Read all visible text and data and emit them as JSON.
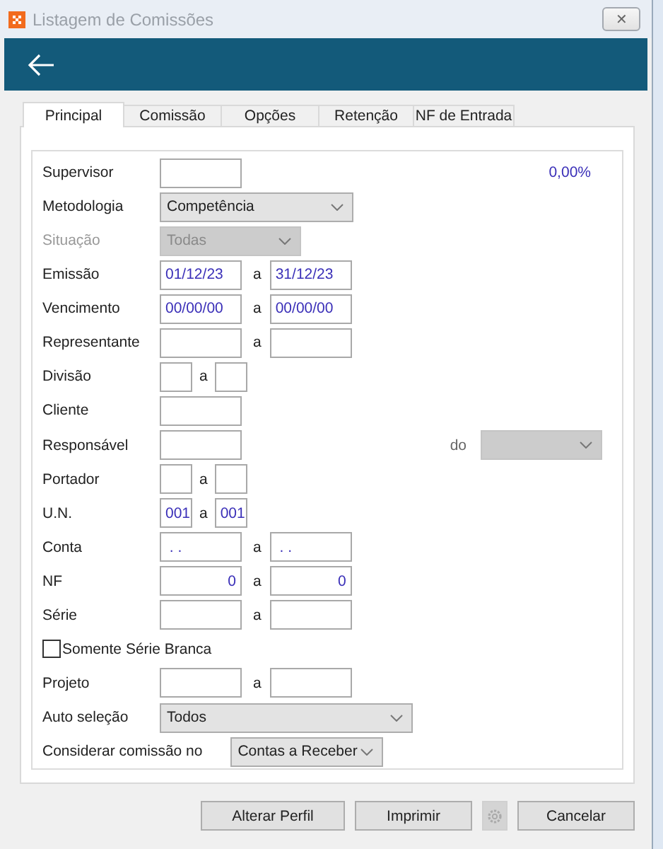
{
  "window": {
    "title": "Listagem de Comissões",
    "close": "✕"
  },
  "tabs": [
    {
      "label": "Principal",
      "selected": true
    },
    {
      "label": "Comissão",
      "selected": false
    },
    {
      "label": "Opções",
      "selected": false
    },
    {
      "label": "Retenção",
      "selected": false
    },
    {
      "label": "NF de Entrada",
      "selected": false
    }
  ],
  "rows": [
    {
      "kind": "input",
      "label": "Supervisor",
      "extra": {
        "kind": "text",
        "text": "0,00%"
      }
    },
    {
      "kind": "select",
      "label": "Metodologia",
      "value": "Competência",
      "disabled": false
    },
    {
      "kind": "select",
      "label": "Situação",
      "value": "Todas",
      "disabled": true
    },
    {
      "kind": "range",
      "label": "Emissão",
      "separator": "a",
      "values": [
        "01/12/23",
        "31/12/23"
      ]
    },
    {
      "kind": "range",
      "label": "Vencimento",
      "separator": "a",
      "values": [
        "00/00/00",
        "00/00/00"
      ]
    },
    {
      "kind": "range",
      "label": "Representante",
      "separator": "a"
    },
    {
      "kind": "range",
      "label": "Divisão",
      "separator": "a"
    },
    {
      "kind": "input",
      "label": "Cliente"
    },
    {
      "kind": "input",
      "label": "Responsável",
      "extra": {
        "kind": "select",
        "label": "do",
        "disabled": true
      }
    },
    {
      "kind": "range",
      "label": "Portador",
      "separator": "a"
    },
    {
      "kind": "range",
      "label": "U.N.",
      "separator": "a",
      "values": [
        "001",
        "001"
      ]
    },
    {
      "kind": "range",
      "label": "Conta",
      "separator": "a",
      "values": [
        " . .",
        " . ."
      ]
    },
    {
      "kind": "range",
      "label": "NF",
      "separator": "a",
      "values": [
        "0",
        "0"
      ]
    },
    {
      "kind": "range",
      "label": "Série",
      "separator": "a"
    },
    {
      "kind": "checkbox",
      "label": "Somente Série Branca",
      "checked": false
    },
    {
      "kind": "range",
      "label": "Projeto",
      "separator": "a"
    },
    {
      "kind": "select",
      "label": "Auto seleção",
      "value": "Todos",
      "disabled": false
    },
    {
      "kind": "select",
      "label": "Considerar comissão no",
      "value": "Contas a Receber",
      "disabled": false
    }
  ],
  "buttons": [
    {
      "kind": "text",
      "label": "Alterar Perfil",
      "disabled": false
    },
    {
      "kind": "text",
      "label": "Imprimir",
      "disabled": false
    },
    {
      "kind": "gear",
      "disabled": true
    },
    {
      "kind": "text",
      "label": "Cancelar",
      "disabled": false
    }
  ]
}
